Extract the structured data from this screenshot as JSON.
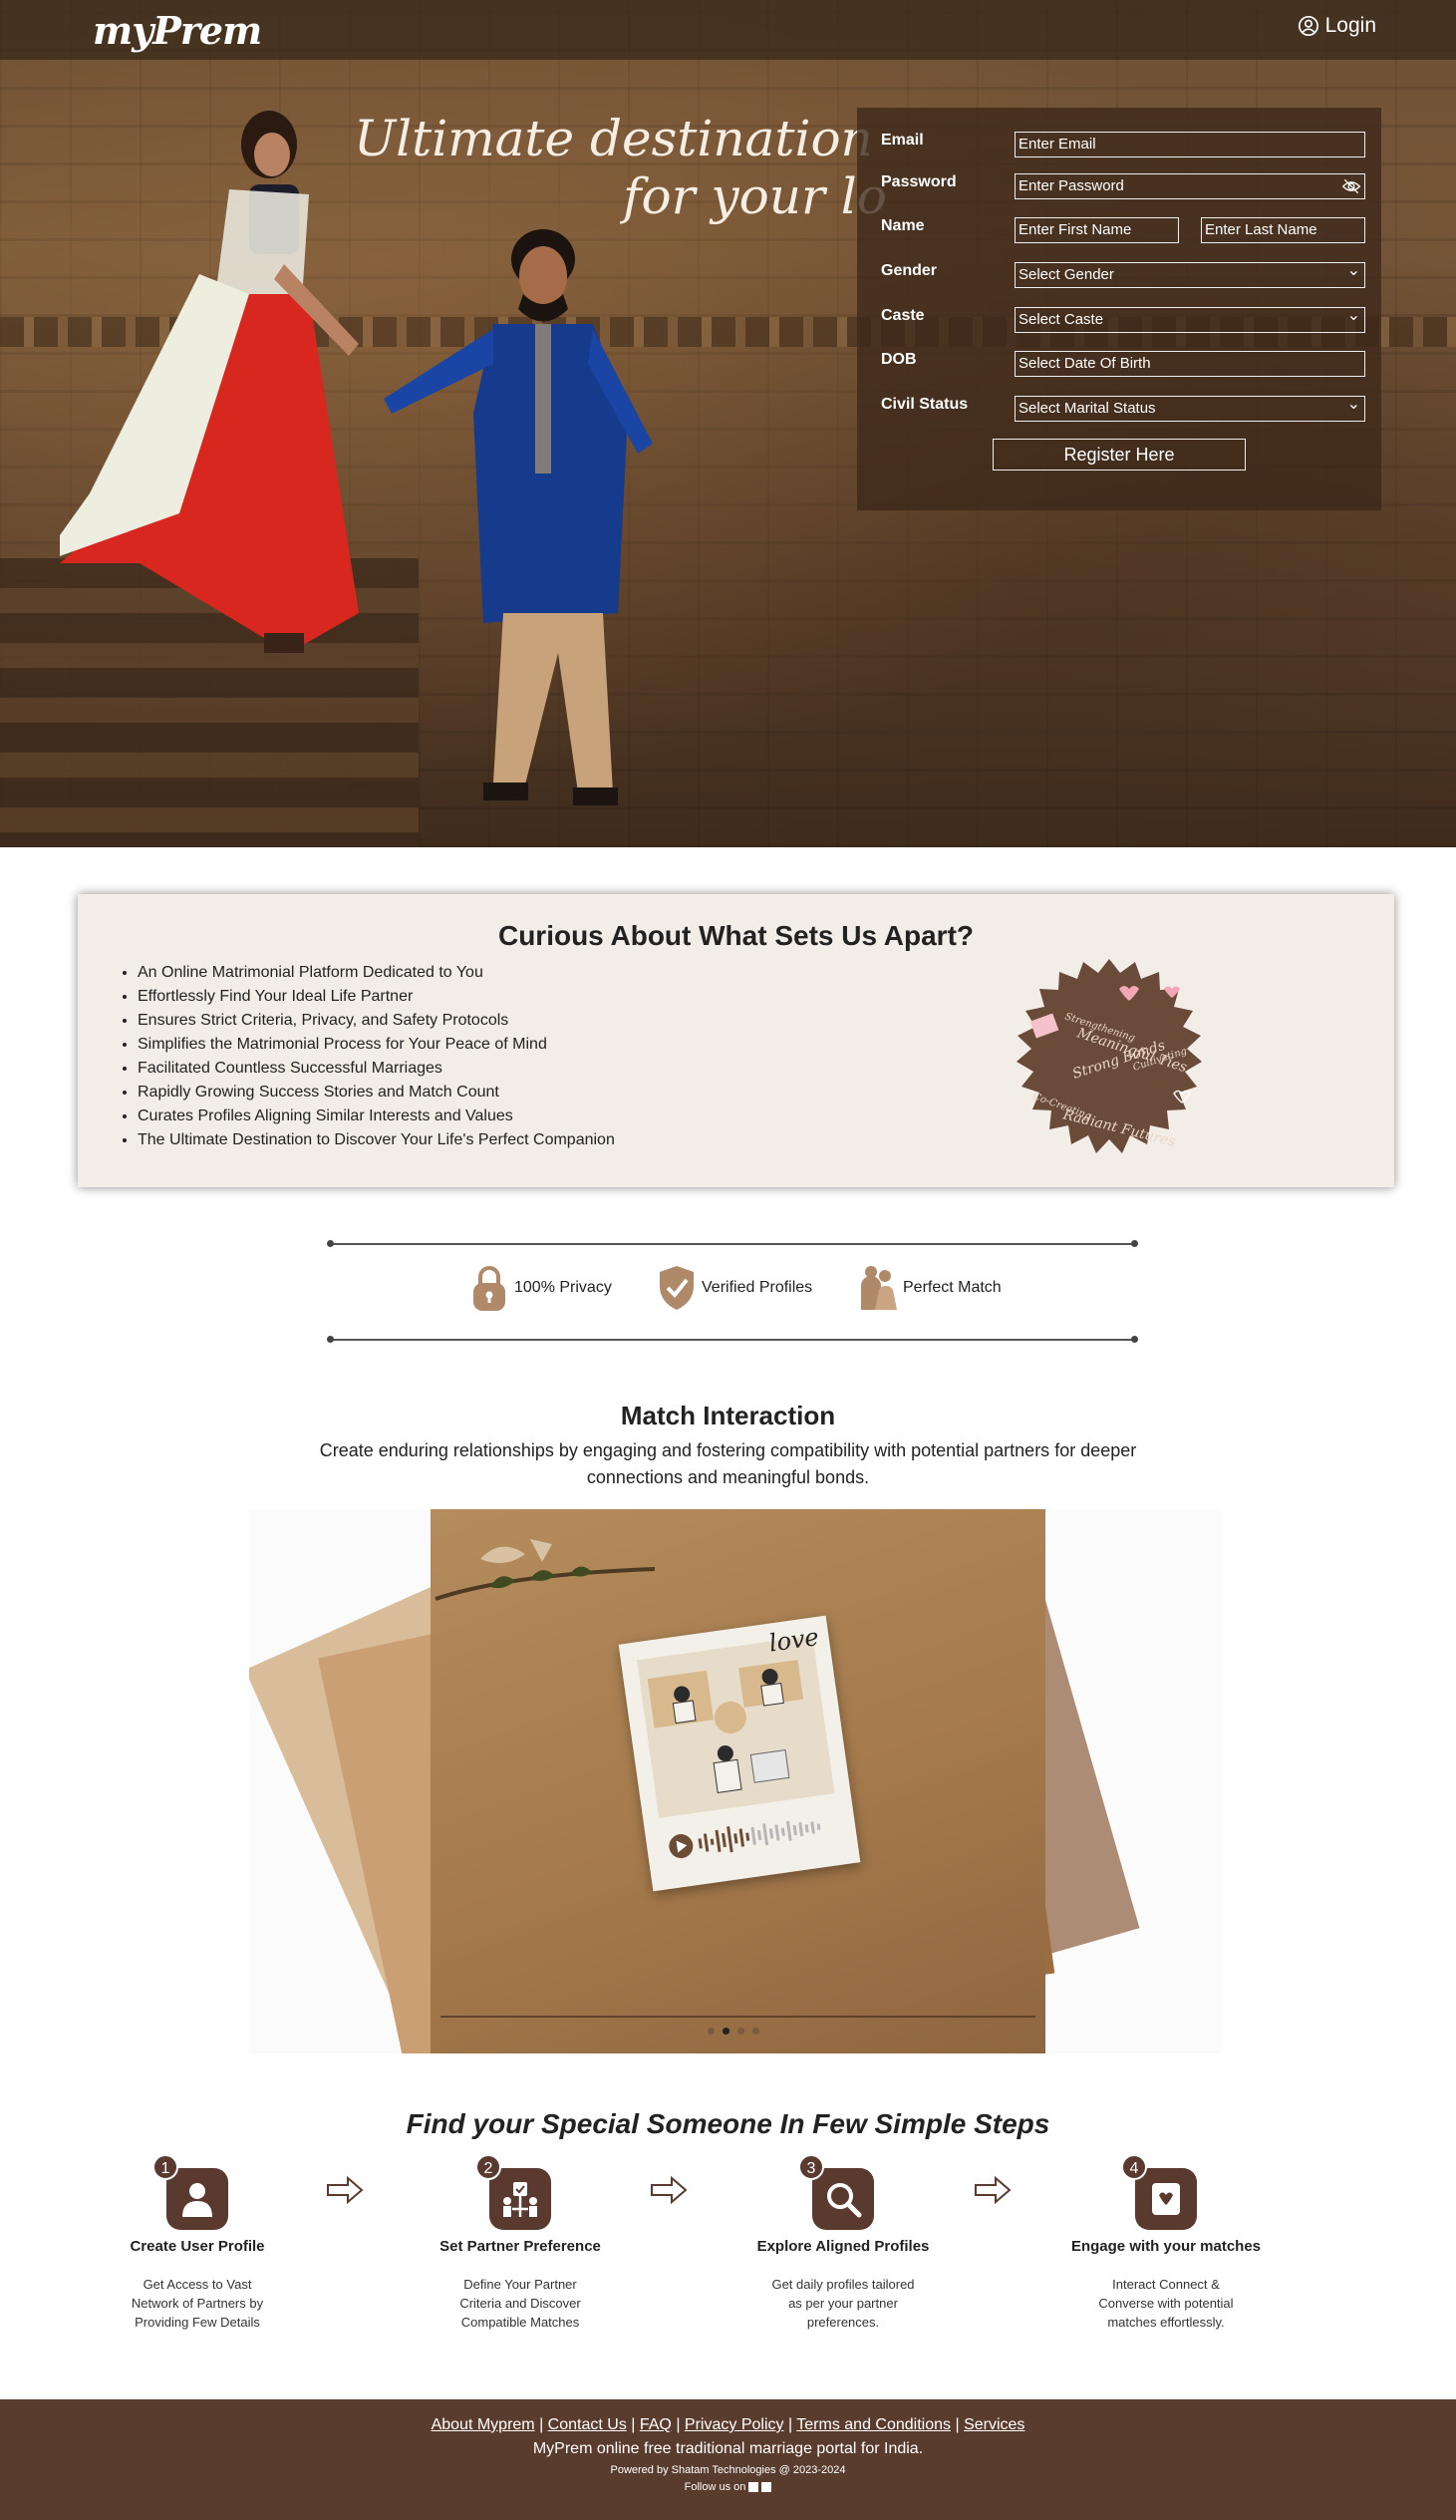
{
  "header": {
    "logo": "myPrem",
    "login": "Login"
  },
  "hero": {
    "tagline_line1": "Ultimate destination",
    "tagline_line2": "for your lo"
  },
  "form": {
    "email": {
      "label": "Email",
      "placeholder": "Enter Email"
    },
    "password": {
      "label": "Password",
      "placeholder": "Enter Password"
    },
    "name": {
      "label": "Name",
      "first_placeholder": "Enter First Name",
      "last_placeholder": "Enter Last Name"
    },
    "gender": {
      "label": "Gender",
      "value": "Select Gender"
    },
    "caste": {
      "label": "Caste",
      "value": "Select Caste"
    },
    "dob": {
      "label": "DOB",
      "placeholder": "Select Date Of Birth"
    },
    "civil_status": {
      "label": "Civil Status",
      "value": "Select Marital Status"
    },
    "submit": "Register Here"
  },
  "apart": {
    "title": "Curious About What Sets Us Apart?",
    "items": [
      "An Online Matrimonial Platform Dedicated to You",
      "Effortlessly Find Your Ideal Life Partner",
      "Ensures Strict Criteria, Privacy, and Safety Protocols",
      "Simplifies the Matrimonial Process for Your Peace of Mind",
      "Facilitated Countless Successful Marriages",
      "Rapidly Growing Success Stories and Match Count",
      "Curates Profiles Aligning Similar Interests and Values",
      "The Ultimate Destination to Discover Your Life's Perfect Companion"
    ],
    "badge_lines": [
      "Strengthening",
      "Meaningful Ties",
      "Cultivating",
      "Strong Bonds",
      "Co-Creating",
      "Radiant Futures"
    ]
  },
  "features": [
    {
      "label": "100% Privacy",
      "icon": "lock-icon"
    },
    {
      "label": "Verified Profiles",
      "icon": "shield-check-icon"
    },
    {
      "label": "Perfect Match",
      "icon": "couple-icon"
    }
  ],
  "match": {
    "title": "Match Interaction",
    "description": "Create enduring relationships by engaging and fostering compatibility with potential partners for deeper connections and meaningful bonds.",
    "slide_text": "love",
    "active_slide": 2,
    "slide_count": 4
  },
  "steps": {
    "title": "Find your Special Someone In Few Simple Steps",
    "items": [
      {
        "num": "1",
        "title": "Create User Profile",
        "desc": "Get Access to Vast Network of Partners by Providing Few Details",
        "icon": "user-icon"
      },
      {
        "num": "2",
        "title": "Set Partner Preference",
        "desc": "Define Your Partner Criteria and Discover Compatible Matches",
        "icon": "preferences-icon"
      },
      {
        "num": "3",
        "title": "Explore Aligned Profiles",
        "desc": "Get daily profiles tailored as per your partner preferences.",
        "icon": "search-icon"
      },
      {
        "num": "4",
        "title": "Engage with your matches",
        "desc": "Interact Connect & Converse with potential matches effortlessly.",
        "icon": "heart-card-icon"
      }
    ]
  },
  "footer": {
    "links": [
      "About Myprem",
      "Contact Us",
      "FAQ",
      "Privacy Policy",
      "Terms and Conditions",
      "Services"
    ],
    "separator": " | ",
    "tagline": "MyPrem online free traditional marriage portal for India.",
    "powered": "Powered by Shatam Technologies @ 2023-2024",
    "follow": "Follow us on"
  },
  "colors": {
    "brand_brown": "#5a3a2f",
    "form_bg": "#3c2819",
    "panel_bg": "#f2ede6"
  }
}
